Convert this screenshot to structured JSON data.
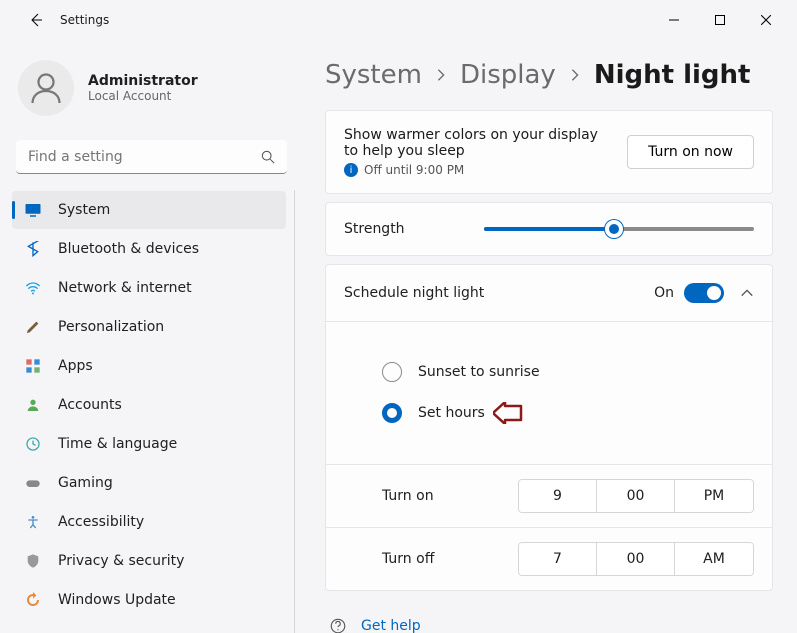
{
  "app": {
    "title": "Settings"
  },
  "user": {
    "name": "Administrator",
    "sub": "Local Account"
  },
  "search": {
    "placeholder": "Find a setting"
  },
  "nav": [
    {
      "id": "system",
      "label": "System",
      "active": true
    },
    {
      "id": "bluetooth",
      "label": "Bluetooth & devices"
    },
    {
      "id": "network",
      "label": "Network & internet"
    },
    {
      "id": "personalization",
      "label": "Personalization"
    },
    {
      "id": "apps",
      "label": "Apps"
    },
    {
      "id": "accounts",
      "label": "Accounts"
    },
    {
      "id": "time",
      "label": "Time & language"
    },
    {
      "id": "gaming",
      "label": "Gaming"
    },
    {
      "id": "accessibility",
      "label": "Accessibility"
    },
    {
      "id": "privacy",
      "label": "Privacy & security"
    },
    {
      "id": "update",
      "label": "Windows Update"
    }
  ],
  "breadcrumbs": {
    "a": "System",
    "b": "Display",
    "c": "Night light"
  },
  "info": {
    "text": "Show warmer colors on your display to help you sleep",
    "status": "Off until 9:00 PM",
    "button": "Turn on now"
  },
  "strength": {
    "label": "Strength",
    "percent": 48
  },
  "schedule": {
    "label": "Schedule night light",
    "state": "On"
  },
  "radios": {
    "sunset": "Sunset to sunrise",
    "sethours": "Set hours"
  },
  "turnon": {
    "label": "Turn on",
    "h": "9",
    "m": "00",
    "p": "PM"
  },
  "turnoff": {
    "label": "Turn off",
    "h": "7",
    "m": "00",
    "p": "AM"
  },
  "help": {
    "label": "Get help"
  },
  "colors": {
    "accent": "#0067c0"
  }
}
